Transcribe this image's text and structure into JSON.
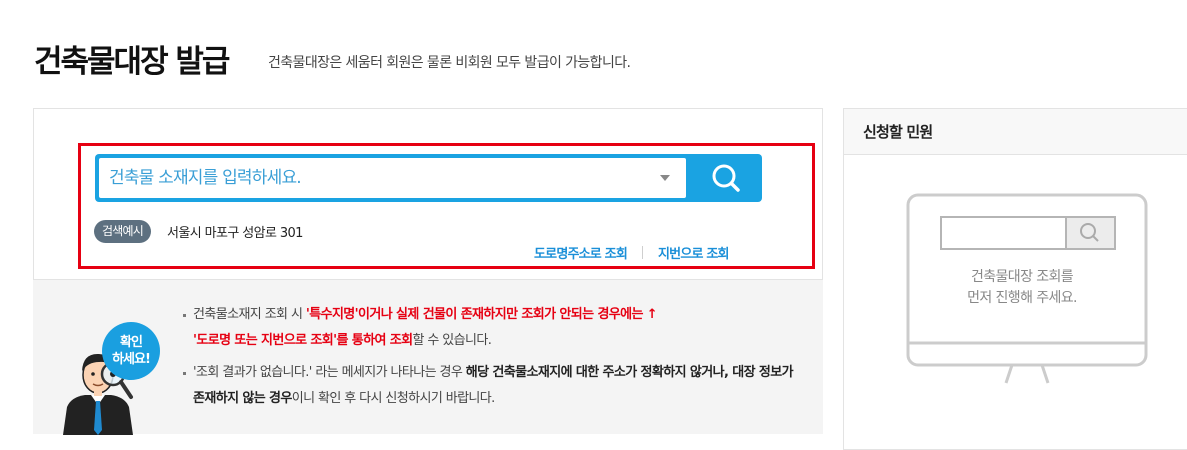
{
  "header": {
    "title": "건축물대장 발급",
    "description": "건축물대장은 세움터 회원은 물론 비회원 모두 발급이 가능합니다."
  },
  "search": {
    "placeholder": "건축물 소재지를 입력하세요.",
    "example_badge": "검색예시",
    "example_text": "서울시 마포구 성암로 301",
    "road_lookup": "도로명주소로 조회",
    "lot_lookup": "지번으로 조회"
  },
  "notice": {
    "bubble_line1": "확인",
    "bubble_line2": "하세요!",
    "item1_prefix": "건축물소재지 조회 시 ",
    "item1_red1": "'특수지명'이거나 실제 건물이 존재하지만 조회가 안되는 경우에는 ↑",
    "item1_red2": "'도로명 또는 지번으로 조회'를 통하여 조회",
    "item1_suffix": "할 수 있습니다.",
    "item2_prefix": "'조회 결과가 없습니다.' 라는 메세지가 나타나는 경우 ",
    "item2_bold1": "해당 건축물소재지에 대한 주소가 정확하지 않거나, 대장 정보가 존재하지 않는 경우",
    "item2_suffix": "이니 확인 후 다시 신청하시기 바랍니다."
  },
  "sidebar": {
    "title": "신청할 민원",
    "empty_line1": "건축물대장 조회를",
    "empty_line2": "먼저 진행해 주세요."
  },
  "colors": {
    "accent": "#1aa3e2",
    "highlight_border": "#e60012",
    "notice_red": "#e60012",
    "badge_bg": "#5d7080"
  },
  "icons": {
    "search_button": "search-icon",
    "dropdown": "chevron-down-icon",
    "illustration": "inspector-magnifier-illustration",
    "sidebar_empty": "monitor-search-icon"
  }
}
